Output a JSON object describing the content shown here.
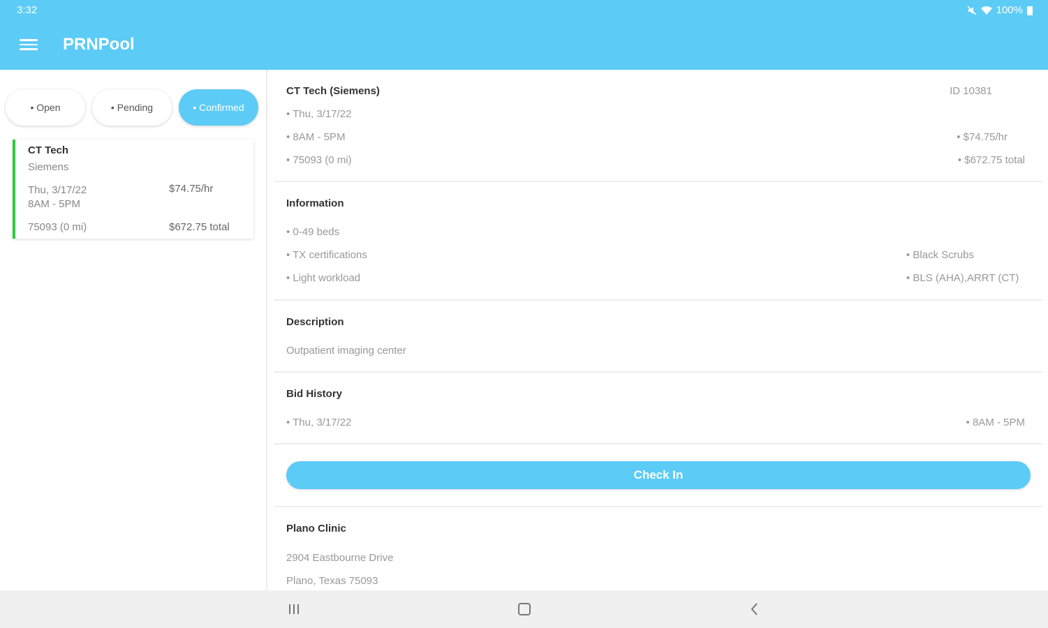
{
  "status": {
    "time": "3:32",
    "battery": "100%"
  },
  "app": {
    "title": "PRNPool",
    "accent": "#5ccbf6"
  },
  "tabs": [
    {
      "label": "• Open"
    },
    {
      "label": "• Pending"
    },
    {
      "label": "• Confirmed",
      "active": true
    }
  ],
  "card": {
    "title": "CT Tech",
    "subtitle": "Siemens",
    "date": "Thu, 3/17/22",
    "time": "8AM - 5PM",
    "rate": "$74.75/hr",
    "location": "75093 (0 mi)",
    "total": "$672.75 total",
    "status_color": "#2ecc40"
  },
  "detail": {
    "title": "CT Tech (Siemens)",
    "id": "ID 10381",
    "date": "• Thu, 3/17/22",
    "time": "• 8AM - 5PM",
    "location": "• 75093 (0 mi)",
    "rate": "• $74.75/hr",
    "total": "• $672.75 total"
  },
  "information": {
    "heading": "Information",
    "left": [
      "• 0-49 beds",
      "• TX certifications",
      "• Light workload"
    ],
    "right": [
      "• Black Scrubs",
      "• BLS (AHA),ARRT (CT)"
    ]
  },
  "description": {
    "heading": "Description",
    "text": "Outpatient imaging center"
  },
  "bid_history": {
    "heading": "Bid History",
    "date": "• Thu, 3/17/22",
    "time": "• 8AM - 5PM"
  },
  "checkin": {
    "label": "Check In"
  },
  "clinic": {
    "name": "Plano Clinic",
    "address1": "2904 Eastbourne Drive",
    "address2": "Plano, Texas 75093"
  },
  "navbar": {
    "icons": [
      "recent-apps-icon",
      "home-icon",
      "back-icon"
    ]
  }
}
